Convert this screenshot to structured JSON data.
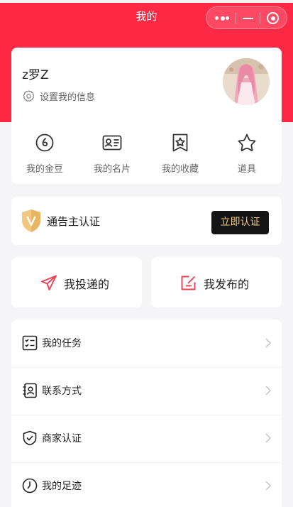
{
  "colors": {
    "brand_red": "#fd2844",
    "icon_red": "#e94257",
    "badge_gold": "#f2c77f",
    "cert_button_bg": "#141414",
    "cert_button_text": "#f0c985",
    "page_bg": "#f5f5f7"
  },
  "nav": {
    "title": "我的",
    "capsule_icons": [
      "more-icon",
      "minimize-icon",
      "close-target-icon"
    ]
  },
  "profile": {
    "username": "z罗Z",
    "edit_label": "设置我的信息",
    "edit_icon": "gear-icon",
    "avatar": "avatar-image"
  },
  "quick_links": [
    {
      "label": "我的金豆",
      "icon": "coin-icon"
    },
    {
      "label": "我的名片",
      "icon": "id-card-icon"
    },
    {
      "label": "我的收藏",
      "icon": "bookmark-star-icon"
    },
    {
      "label": "道具",
      "icon": "star-icon"
    }
  ],
  "certification": {
    "label": "通告主认证",
    "badge_icon": "shield-v-icon",
    "button_label": "立即认证"
  },
  "actions": [
    {
      "label": "我投递的",
      "icon": "paper-plane-icon"
    },
    {
      "label": "我发布的",
      "icon": "edit-square-icon"
    }
  ],
  "menu": [
    {
      "label": "我的任务",
      "icon": "task-list-icon"
    },
    {
      "label": "联系方式",
      "icon": "contact-card-icon"
    },
    {
      "label": "商家认证",
      "icon": "shield-check-icon"
    },
    {
      "label": "我的足迹",
      "icon": "clock-icon"
    }
  ]
}
